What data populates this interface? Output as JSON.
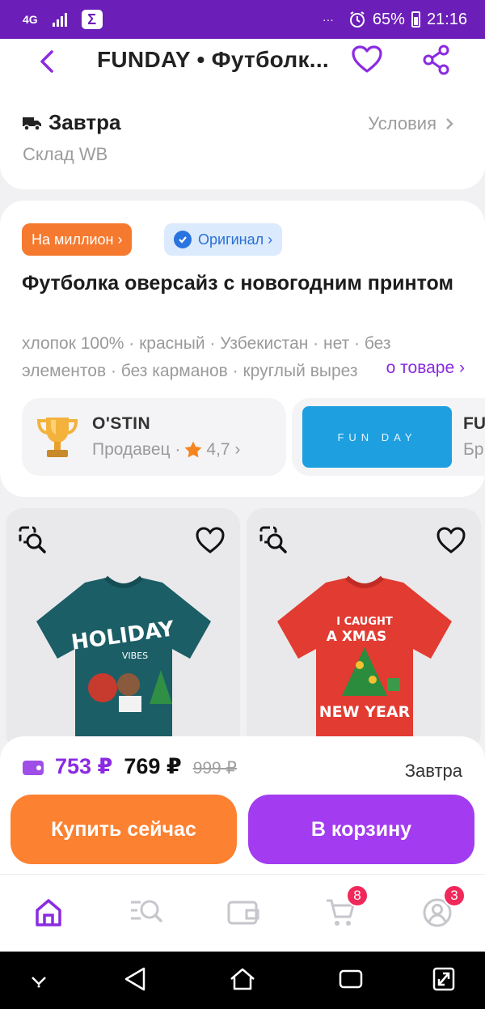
{
  "status_bar": {
    "network": "4G",
    "carrier_icon": "Σ",
    "dots": "···",
    "battery": "65%",
    "time": "21:16"
  },
  "header": {
    "title": "FUNDAY • Футболк...",
    "delivery_label": "Завтра",
    "terms_label": "Условия",
    "warehouse": "Склад WB"
  },
  "product": {
    "badge_million": "На миллион ›",
    "badge_original": "Оригинал ›",
    "name": "Футболка оверсайз с новогодним принтом",
    "specs": "хлопок 100% · красный · Узбекистан · нет · без элементов · без карманов · круглый вырез",
    "more_link": "о товаре ›",
    "seller": {
      "name": "O'STIN",
      "role": "Продавец ·",
      "rating": "4,7 ›"
    },
    "brand": {
      "name": "FU",
      "type": "Бр",
      "logo_text": "FUN DAY"
    }
  },
  "recommendations": [
    {
      "color": "#1b5e66",
      "print": "HOLIDAY"
    },
    {
      "color": "#e23b32",
      "print": "NEW YEAR"
    }
  ],
  "purchase": {
    "wallet_price": "753 ₽",
    "price": "769 ₽",
    "old_price": "999 ₽",
    "delivery": "Завтра",
    "buy_now": "Купить сейчас",
    "to_cart": "В корзину"
  },
  "tabbar": {
    "cart_count": "8",
    "profile_count": "3"
  },
  "colors": {
    "brand_purple": "#6b1fb8",
    "accent_purple": "#a33cf0",
    "orange": "#fc8130",
    "badge_red": "#f0295a"
  }
}
